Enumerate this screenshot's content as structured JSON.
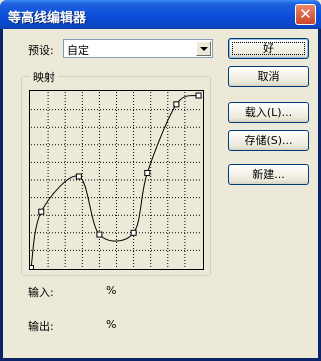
{
  "window": {
    "title": "等高线编辑器",
    "close_glyph": "✕"
  },
  "preset": {
    "label": "预设:",
    "value": "自定"
  },
  "mapping": {
    "group_label": "映射"
  },
  "curve": {
    "control_points": [
      [
        0,
        0
      ],
      [
        6,
        32
      ],
      [
        28,
        52
      ],
      [
        40,
        19
      ],
      [
        60,
        20
      ],
      [
        68,
        54
      ],
      [
        85,
        93
      ],
      [
        98,
        98
      ]
    ]
  },
  "readout": {
    "input_label": "输入:",
    "input_value": "%",
    "output_label": "输出:",
    "output_value": "%"
  },
  "buttons": {
    "ok": "好",
    "cancel": "取消",
    "load": "载入(L)...",
    "save": "存储(S)...",
    "new": "新建..."
  }
}
